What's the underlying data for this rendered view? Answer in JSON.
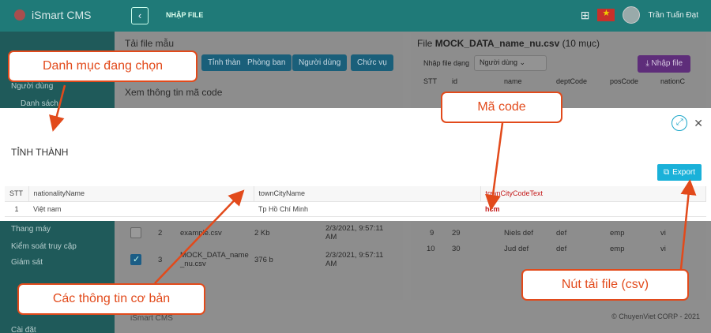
{
  "app": {
    "logo_text": "iSmart CMS",
    "page_heading": "NHẬP FILE",
    "user_name": "Trần Tuấn Đạt"
  },
  "sidebar": {
    "items": [
      "Người dùng",
      "Danh sách",
      "Thang máy",
      "Kiểm soát truy cập",
      "Giám sát",
      "Cài đặt"
    ]
  },
  "template_panel": {
    "title": "Tải file mẫu",
    "chips": [
      "Tỉnh thành",
      "Phòng ban",
      "Người dùng",
      "Chức vụ"
    ],
    "code_title": "Xem thông tin mã code"
  },
  "import_panel": {
    "title_prefix": "File",
    "file_name": "MOCK_DATA_name_nu.csv",
    "count": "(10 mục)",
    "import_label": "Nhập file dạng",
    "import_select": "Người dùng",
    "import_button": "Nhập file",
    "columns": [
      "STT",
      "id",
      "name",
      "deptCode",
      "posCode",
      "nationC"
    ]
  },
  "file_list": {
    "rows": [
      {
        "stt": "2",
        "name": "example.csv",
        "size": "2 Kb",
        "date": "2/3/2021, 9:57:11 AM",
        "checked": false
      },
      {
        "stt": "3",
        "name": "MOCK_DATA_name _nu.csv",
        "size": "376 b",
        "date": "2/3/2021, 9:57:11 AM",
        "checked": true
      }
    ]
  },
  "preview_rows": [
    {
      "stt": "9",
      "id": "29",
      "name": "Niels def",
      "dept": "def",
      "pos": "emp",
      "nation": "vi"
    },
    {
      "stt": "10",
      "id": "30",
      "name": "Jud def",
      "dept": "def",
      "pos": "emp",
      "nation": "vi"
    }
  ],
  "footer": {
    "brand": "iSmart CMS",
    "copyright": "© ChuyenViet CORP - 2021"
  },
  "modal": {
    "title": "TỈNH THÀNH",
    "export_label": "Export",
    "columns": [
      "STT",
      "nationalityName",
      "townCityName",
      "townCityCodeText"
    ],
    "rows": [
      {
        "stt": "1",
        "nationality": "Việt nam",
        "town": "Tp Hồ Chí Minh",
        "code": "hcm"
      }
    ]
  },
  "callouts": {
    "selected_category": "Danh mục đang chọn",
    "code": "Mã code",
    "basic_info": "Các thông tin cơ bản",
    "download_button": "Nút tải file (csv)"
  },
  "colors": {
    "topbar": "#1f7a78",
    "accent": "#1ab1d9",
    "annotation": "#e24a1b",
    "code_text": "#c41a1a"
  }
}
